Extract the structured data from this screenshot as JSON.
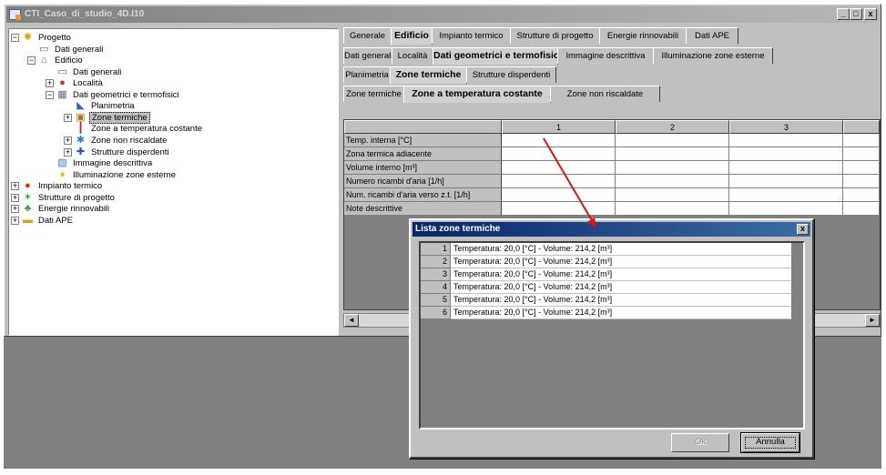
{
  "window": {
    "title": "CTI_Caso_di_studio_4D.I10",
    "buttons": {
      "minimize": "_",
      "maximize": "□",
      "close": "x"
    }
  },
  "tree": {
    "items": [
      {
        "label": "Progetto",
        "icon": "sun-icon",
        "level": 0,
        "expander": "−"
      },
      {
        "label": "Dati generali",
        "icon": "document-icon",
        "level": 1,
        "expander": ""
      },
      {
        "label": "Edificio",
        "icon": "house-icon",
        "level": 1,
        "expander": "−"
      },
      {
        "label": "Dati generali",
        "icon": "document-icon",
        "level": 2,
        "expander": ""
      },
      {
        "label": "Località",
        "icon": "location-icon",
        "level": 2,
        "expander": "+"
      },
      {
        "label": "Dati geometrici e termofisici",
        "icon": "ruler-icon",
        "level": 2,
        "expander": "−"
      },
      {
        "label": "Planimetria",
        "icon": "plan-icon",
        "level": 3,
        "expander": ""
      },
      {
        "label": "Zone termiche",
        "icon": "zone-icon",
        "level": 3,
        "expander": "+",
        "selected": true
      },
      {
        "label": "Zone a temperatura costante",
        "icon": "thermometer-icon",
        "level": 3,
        "expander": ""
      },
      {
        "label": "Zone non riscaldate",
        "icon": "snowflake-icon",
        "level": 3,
        "expander": "+"
      },
      {
        "label": "Strutture disperdenti",
        "icon": "wall-icon",
        "level": 3,
        "expander": "+"
      },
      {
        "label": "Immagine descrittiva",
        "icon": "image-icon",
        "level": 2,
        "expander": ""
      },
      {
        "label": "Illuminazione zone esterne",
        "icon": "bulb-icon",
        "level": 2,
        "expander": ""
      },
      {
        "label": "Impianto termico",
        "icon": "flame-icon",
        "level": 0,
        "expander": "+"
      },
      {
        "label": "Strutture di progetto",
        "icon": "structure-icon",
        "level": 0,
        "expander": "+"
      },
      {
        "label": "Energie rinnovabili",
        "icon": "leaf-icon",
        "level": 0,
        "expander": "+"
      },
      {
        "label": "Dati APE",
        "icon": "certificate-icon",
        "level": 0,
        "expander": "+"
      }
    ]
  },
  "tabs": {
    "level1": [
      "Generale",
      "Edificio",
      "Impianto termico",
      "Strutture di progetto",
      "Energie rinnovabili",
      "Dati APE"
    ],
    "level1_active": 1,
    "level2": [
      "Dati generali",
      "Località",
      "Dati geometrici e termofisici",
      "Immagine descrittiva",
      "Illuminazione zone esterne"
    ],
    "level2_active": 2,
    "level3": [
      "Planimetria",
      "Zone termiche",
      "Strutture disperdenti"
    ],
    "level3_active": 1,
    "level4": [
      "Zone termiche",
      "Zone a temperatura costante",
      "Zone non riscaldate"
    ],
    "level4_active": 1
  },
  "grid": {
    "columns": [
      "1",
      "2",
      "3"
    ],
    "rows": [
      "Temp. interna [°C]",
      "Zona termica adiacente",
      "Volume interno [m³]",
      "Numero ricambi d'aria [1/h]",
      "Num. ricambi d'aria verso z.t. [1/h]",
      "Note descrittive"
    ],
    "scroll_left": "◄",
    "scroll_right": "►"
  },
  "dialog": {
    "title": "Lista zone termiche",
    "close": "x",
    "items": [
      {
        "num": "1",
        "text": "Temperatura: 20,0 [°C] - Volume: 214,2 [m³]"
      },
      {
        "num": "2",
        "text": "Temperatura: 20,0 [°C] - Volume: 214,2 [m³]"
      },
      {
        "num": "3",
        "text": "Temperatura: 20,0 [°C] - Volume: 214,2 [m³]"
      },
      {
        "num": "4",
        "text": "Temperatura: 20,0 [°C] - Volume: 214,2 [m³]"
      },
      {
        "num": "5",
        "text": "Temperatura: 20,0 [°C] - Volume: 214,2 [m³]"
      },
      {
        "num": "6",
        "text": "Temperatura: 20,0 [°C] - Volume: 214,2 [m³]"
      }
    ],
    "ok_label": "Ok",
    "cancel_label": "Annulla"
  },
  "colors": {
    "arrow": "#e01010",
    "dialog_title": "#0a246a",
    "inactive_title": "#808080"
  }
}
